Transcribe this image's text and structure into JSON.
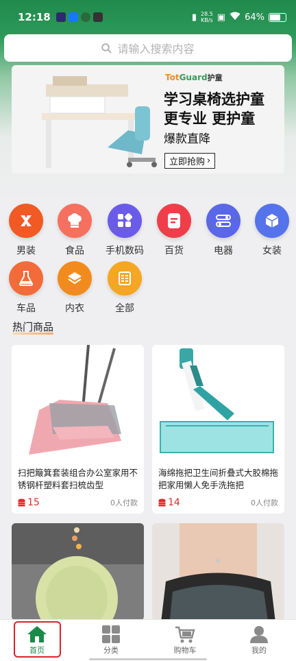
{
  "status_bar": {
    "time": "12:18",
    "net_speed_value": "28.5",
    "net_speed_unit": "KB/s",
    "battery": "64%"
  },
  "search": {
    "placeholder": "请输入搜索内容",
    "icon": "search-icon"
  },
  "banner": {
    "brand_latin_1": "Tot",
    "brand_latin_2": "Guard",
    "brand_cn": "护童",
    "line1": "学习桌椅选护童",
    "line2": "更专业 更护童",
    "line3": "爆款直降",
    "button": "立即抢购",
    "button_arrow": "›"
  },
  "categories": [
    {
      "label": "男装",
      "icon": "menswear-icon",
      "color": "#f15a24"
    },
    {
      "label": "食品",
      "icon": "chef-hat-icon",
      "color": "#f5705e"
    },
    {
      "label": "手机数码",
      "icon": "grid-icon",
      "color": "#6a5ce8"
    },
    {
      "label": "百货",
      "icon": "document-icon",
      "color": "#ef3e4a"
    },
    {
      "label": "电器",
      "icon": "toggle-icon",
      "color": "#5a67e8"
    },
    {
      "label": "女装",
      "icon": "cube-icon",
      "color": "#5573ea"
    },
    {
      "label": "车品",
      "icon": "flask-icon",
      "color": "#f26b3a"
    },
    {
      "label": "内衣",
      "icon": "layers-icon",
      "color": "#f28b1e"
    },
    {
      "label": "全部",
      "icon": "list-icon",
      "color": "#f5a623"
    }
  ],
  "section_title": "热门商品",
  "products": [
    {
      "name": "扫把簸箕套装组合办公室家用不锈钢杆塑料套扫梳齿型",
      "price": "15",
      "paid": "0人付款"
    },
    {
      "name": "海绵拖把卫生间折叠式大胶棉拖把家用懒人免手洗拖把",
      "price": "14",
      "paid": "0人付款"
    },
    {
      "name": "",
      "price": "",
      "paid": ""
    },
    {
      "name": "",
      "price": "",
      "paid": ""
    }
  ],
  "tabs": [
    {
      "label": "首页",
      "icon": "home-icon",
      "active": true
    },
    {
      "label": "分类",
      "icon": "category-grid-icon",
      "active": false
    },
    {
      "label": "购物车",
      "icon": "cart-icon",
      "active": false
    },
    {
      "label": "我的",
      "icon": "user-icon",
      "active": false
    }
  ],
  "colors": {
    "brand_green": "#1b8a49",
    "price_red": "#e02b2b",
    "highlight_red": "#d9232d"
  }
}
